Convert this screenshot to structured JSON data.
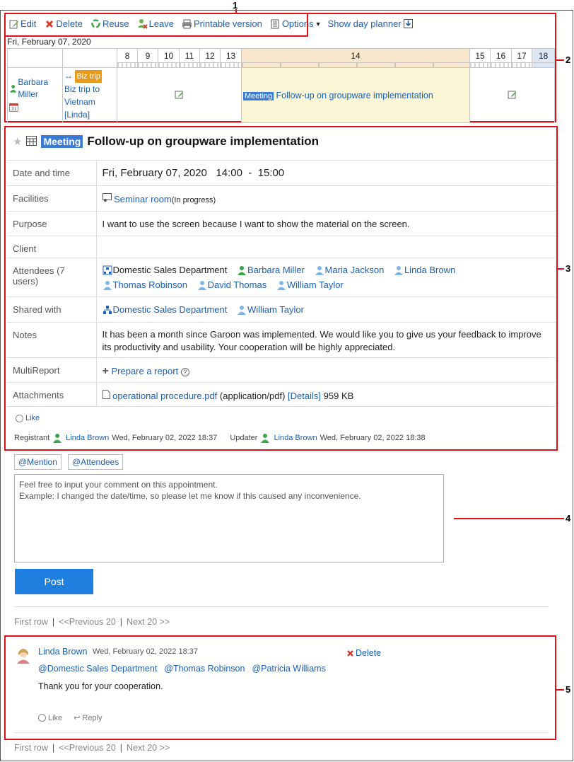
{
  "callouts": [
    "1",
    "2",
    "3",
    "4",
    "5"
  ],
  "toolbar": {
    "edit": "Edit",
    "delete": "Delete",
    "reuse": "Reuse",
    "leave": "Leave",
    "printable": "Printable version",
    "options": "Options",
    "day_planner": "Show day planner"
  },
  "schedule": {
    "date": "Fri, February 07, 2020",
    "hours": [
      "8",
      "9",
      "10",
      "11",
      "12",
      "13",
      "14",
      "15",
      "16",
      "17",
      "18"
    ],
    "user_name": "Barbara Miller",
    "biz_badge": "Biz trip",
    "biz_text": "Biz trip to Vietnam [Linda]",
    "meeting_badge": "Meeting",
    "meeting_title": "Follow-up on groupware implementation"
  },
  "detail": {
    "badge": "Meeting",
    "title": "Follow-up on groupware implementation",
    "rows": {
      "datetime_label": "Date and time",
      "datetime_value": "Fri, February 07, 2020   14:00  -  15:00",
      "facilities_label": "Facilities",
      "facility": "Seminar room",
      "facility_status": "(In progress)",
      "purpose_label": "Purpose",
      "purpose_value": "I want to use the screen because I want to show the material on the screen.",
      "client_label": "Client",
      "attendees_label": "Attendees (7 users)",
      "attendees": [
        "Domestic Sales Department",
        "Barbara Miller",
        "Maria Jackson",
        "Linda Brown",
        "Thomas Robinson",
        "David Thomas",
        "William Taylor"
      ],
      "shared_label": "Shared with",
      "shared": [
        "Domestic Sales Department",
        "William Taylor"
      ],
      "notes_label": "Notes",
      "notes_value": "It has been a month since Garoon was implemented. We would like you to give us your feedback to improve its productivity and usability. Your cooperation will be highly appreciated.",
      "multireport_label": "MultiReport",
      "prepare_report": "Prepare a report",
      "attachments_label": "Attachments",
      "file_name": "operational procedure.pdf",
      "file_type": "(application/pdf)",
      "details_link": "[Details]",
      "file_size": "959 KB"
    },
    "like": "Like",
    "registrant_label": "Registrant",
    "registrant": "Linda Brown",
    "registrant_date": "Wed, February 02, 2022 18:37",
    "updater_label": "Updater",
    "updater": "Linda Brown",
    "updater_date": "Wed, February 02, 2022 18:38"
  },
  "comment": {
    "mention_btn": "@Mention",
    "attendees_btn": "@Attendees",
    "placeholder_line1": "Feel free to input your comment on this appointment.",
    "placeholder_line2": "Example: I changed the date/time, so please let me know if this caused any inconvenience.",
    "post": "Post"
  },
  "pager": {
    "first": "First row",
    "sep": "|",
    "prev": "<<Previous 20",
    "next": "Next 20 >>"
  },
  "post": {
    "author": "Linda Brown",
    "date": "Wed, February 02, 2022 18:37",
    "delete": "Delete",
    "mentions": [
      "@Domestic Sales Department",
      "@Thomas Robinson",
      "@Patricia Williams"
    ],
    "body": "Thank you for your cooperation.",
    "like": "Like",
    "reply": "Reply"
  }
}
